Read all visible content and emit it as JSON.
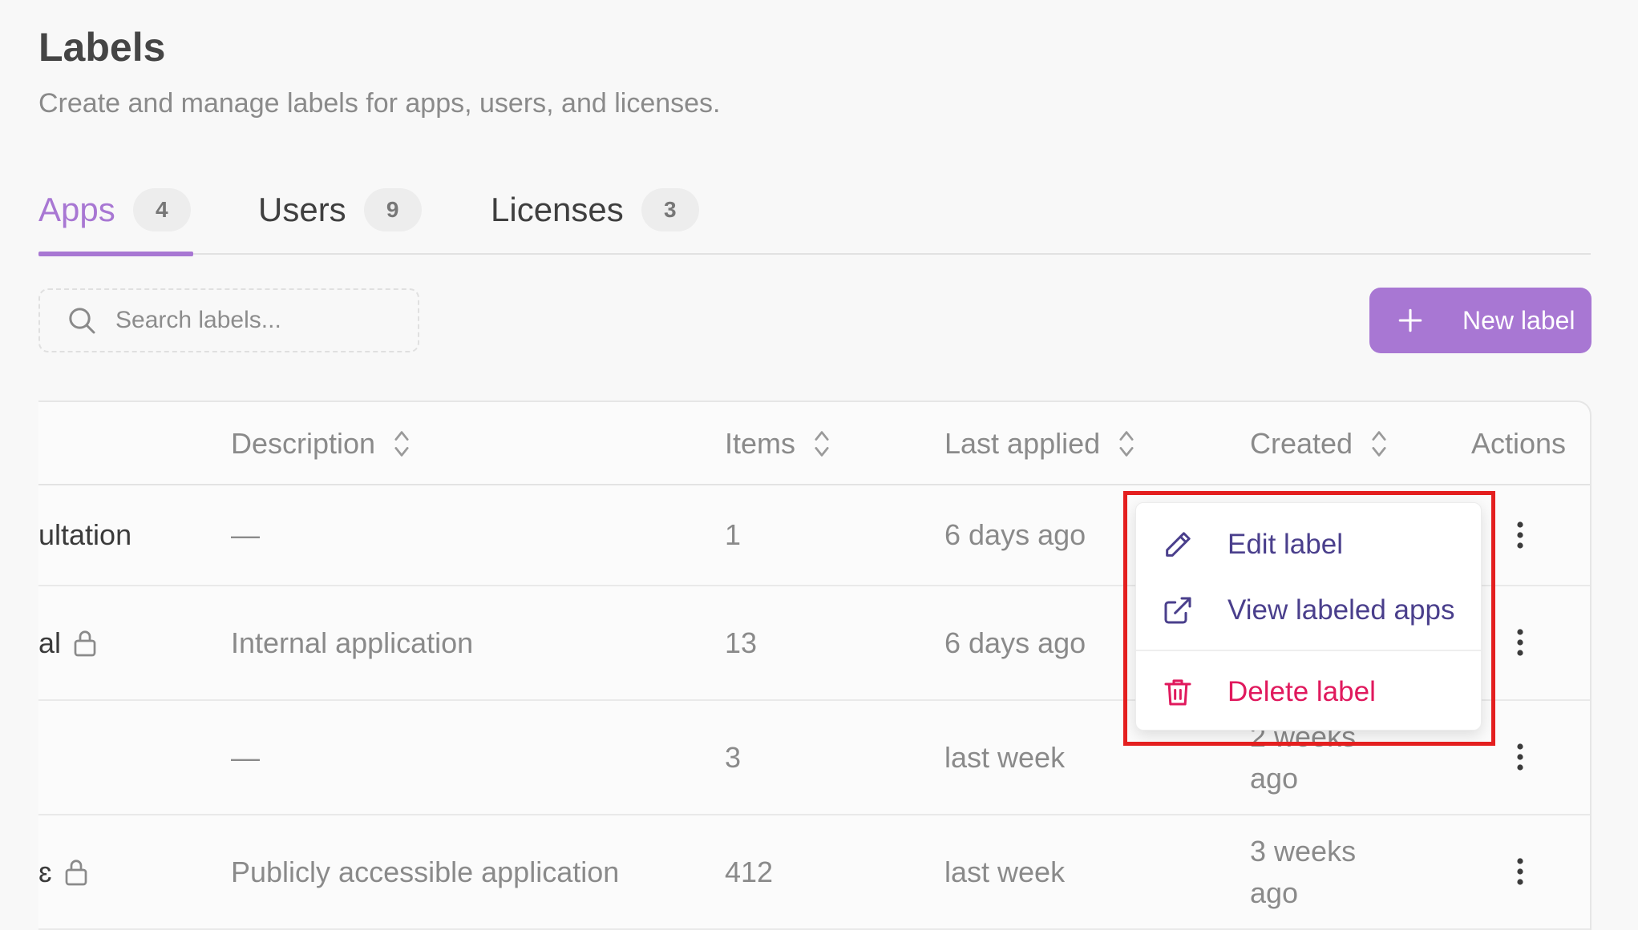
{
  "page": {
    "title": "Labels",
    "subtitle": "Create and manage labels for apps, users, and licenses."
  },
  "tabs": [
    {
      "label": "Apps",
      "count": "4",
      "active": true
    },
    {
      "label": "Users",
      "count": "9",
      "active": false
    },
    {
      "label": "Licenses",
      "count": "3",
      "active": false
    }
  ],
  "search": {
    "placeholder": "Search labels..."
  },
  "toolbar": {
    "new_label": "New label"
  },
  "table": {
    "columns": {
      "description": "Description",
      "items": "Items",
      "last_applied": "Last applied",
      "created": "Created",
      "actions": "Actions"
    },
    "rows": [
      {
        "name": "ultation",
        "locked": false,
        "description": "—",
        "items": "1",
        "last_applied": "6 days ago",
        "created": ""
      },
      {
        "name": "al",
        "locked": true,
        "description": "Internal application",
        "items": "13",
        "last_applied": "6 days ago",
        "created": ""
      },
      {
        "name": "",
        "locked": false,
        "description": "—",
        "items": "3",
        "last_applied": "last week",
        "created": "2 weeks ago"
      },
      {
        "name": "ɛ",
        "locked": true,
        "description": "Publicly accessible application",
        "items": "412",
        "last_applied": "last week",
        "created": "3 weeks ago"
      }
    ]
  },
  "menu": {
    "edit": "Edit label",
    "view": "View labeled apps",
    "delete": "Delete label"
  },
  "colors": {
    "accent": "#a877d3",
    "danger": "#e0195d",
    "menu_text": "#4a3f8c",
    "highlight": "#e41f1f"
  }
}
